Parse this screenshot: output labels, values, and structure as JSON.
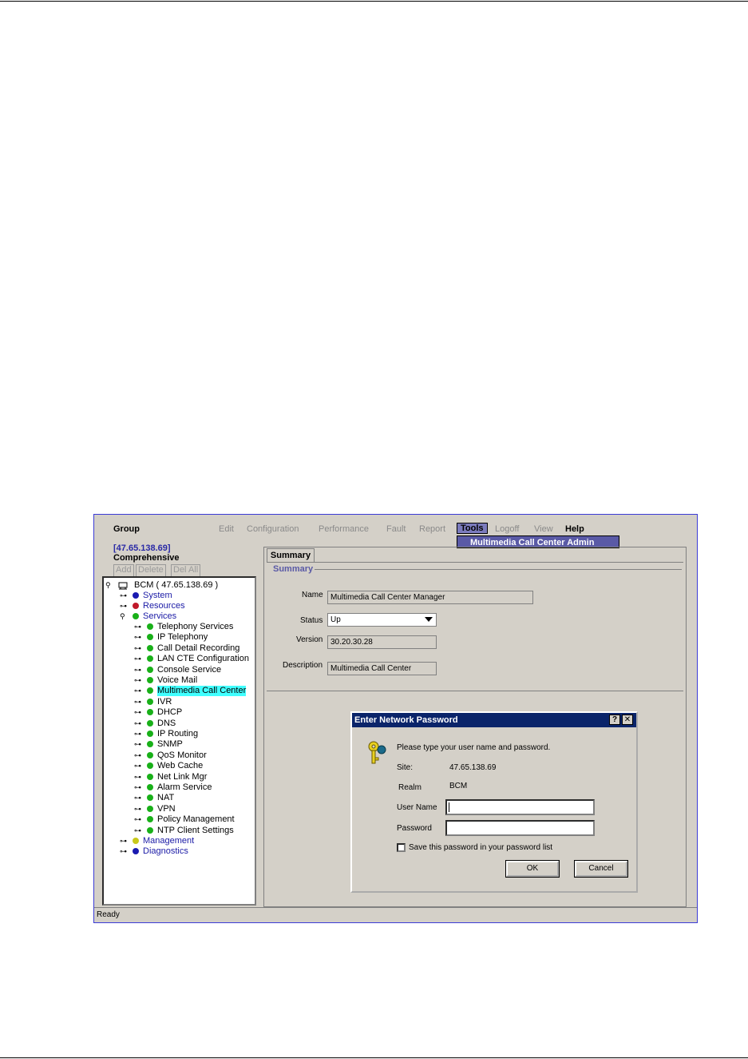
{
  "menu": {
    "group": "Group",
    "edit": "Edit",
    "configuration": "Configuration",
    "performance": "Performance",
    "fault": "Fault",
    "report": "Report",
    "tools": "Tools",
    "logoff": "Logoff",
    "view": "View",
    "help": "Help",
    "tools_dropdown_item": "Multimedia Call Center Admin"
  },
  "host": {
    "ip": "[47.65.138.69]",
    "name": "Comprehensive"
  },
  "toolbar": {
    "add": "Add",
    "delete": "Delete",
    "del_all": "Del All"
  },
  "tree": {
    "root": "BCM ( 47.65.138.69 )",
    "system": "System",
    "resources": "Resources",
    "services": "Services",
    "service_items": [
      "Telephony Services",
      "IP Telephony",
      "Call Detail Recording",
      "LAN CTE Configuration",
      "Console Service",
      "Voice Mail",
      "Multimedia Call Center",
      "IVR",
      "DHCP",
      "DNS",
      "IP Routing",
      "SNMP",
      "QoS Monitor",
      "Web Cache",
      "Net Link Mgr",
      "Alarm Service",
      "NAT",
      "VPN",
      "Policy Management",
      "NTP Client Settings"
    ],
    "management": "Management",
    "diagnostics": "Diagnostics"
  },
  "summary": {
    "tab": "Summary",
    "group_title": "Summary",
    "name_label": "Name",
    "name_value": "Multimedia Call Center Manager",
    "status_label": "Status",
    "status_value": "Up",
    "version_label": "Version",
    "version_value": "30.20.30.28",
    "description_label": "Description",
    "description_value": "Multimedia Call Center"
  },
  "dialog": {
    "title": "Enter Network Password",
    "help": "?",
    "close": "✕",
    "prompt": "Please type your user name and password.",
    "site_label": "Site:",
    "site_value": "47.65.138.69",
    "realm_label": "Realm",
    "realm_value": "BCM",
    "username_label": "User Name",
    "password_label": "Password",
    "save_label": "Save this password in your password list",
    "ok": "OK",
    "cancel": "Cancel"
  },
  "statusbar": "Ready",
  "colors": {
    "green": "#19b019",
    "blue": "#1a1ab0",
    "red": "#c0182a",
    "yellow": "#c8c81a",
    "highlight": "#40ffff"
  }
}
